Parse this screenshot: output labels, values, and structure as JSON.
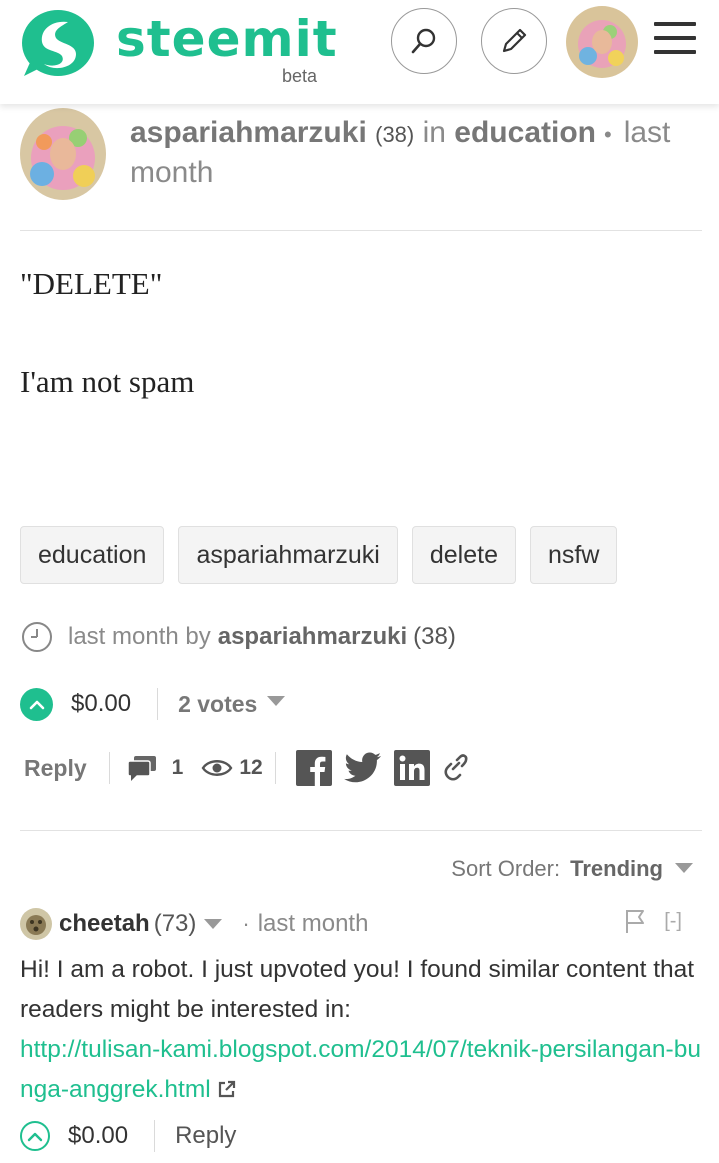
{
  "brand": {
    "name": "steemit",
    "beta": "beta",
    "accent": "#1fbf8f"
  },
  "nav": {
    "search_icon": "search-icon",
    "edit_icon": "pencil-icon",
    "menu_icon": "hamburger-icon"
  },
  "post": {
    "author": "aspariahmarzuki",
    "author_rep": "(38)",
    "in_word": "in",
    "category": "education",
    "dot": "•",
    "time": "last month",
    "title": "\"DELETE\"",
    "body": "I'am not spam",
    "tags": [
      "education",
      "aspariahmarzuki",
      "delete",
      "nsfw"
    ],
    "footer_time": "last month by",
    "footer_author": "aspariahmarzuki",
    "footer_rep": "(38)",
    "payout": "$0.00",
    "votes": "2 votes",
    "reply": "Reply",
    "comment_count": "1",
    "view_count": "12"
  },
  "comments": {
    "sort_label": "Sort Order:",
    "sort_value": "Trending",
    "items": [
      {
        "author": "cheetah",
        "rep": "(73)",
        "dot": "·",
        "time": "last month",
        "collapse": "[-]",
        "text": "Hi! I am a robot. I just upvoted you! I found similar content that readers might be interested in:",
        "link": "http://tulisan-kami.blogspot.com/2014/07/teknik-persilangan-bunga-anggrek.html",
        "payout": "$0.00",
        "reply": "Reply"
      }
    ]
  }
}
